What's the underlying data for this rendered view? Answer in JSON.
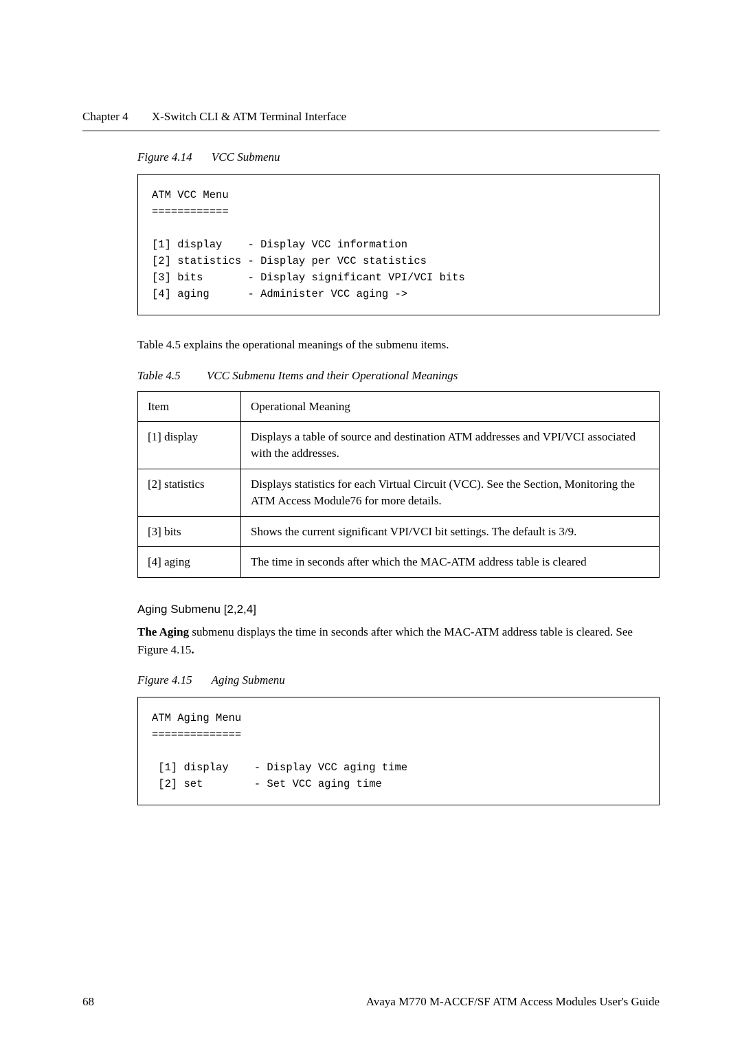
{
  "header": {
    "chapter_label": "Chapter 4",
    "chapter_title": "X-Switch CLI & ATM Terminal Interface"
  },
  "figure_4_14": {
    "label": "Figure 4.14",
    "title": "VCC Submenu",
    "code": "ATM VCC Menu\n============\n\n[1] display    - Display VCC information\n[2] statistics - Display per VCC statistics\n[3] bits       - Display significant VPI/VCI bits\n[4] aging      - Administer VCC aging ->"
  },
  "explain_text": "Table 4.5 explains the operational meanings of the submenu items.",
  "table_4_5": {
    "label": "Table 4.5",
    "title": "VCC Submenu Items and their Operational Meanings",
    "header_item": "Item",
    "header_meaning": "Operational Meaning",
    "rows": [
      {
        "item": "[1] display",
        "meaning": "Displays a table of source and destination ATM addresses and  VPI/VCI associated with the addresses."
      },
      {
        "item": "[2] statistics",
        "meaning": "Displays statistics for each Virtual Circuit (VCC). See the Section, Monitoring the ATM Access Module76 for more details."
      },
      {
        "item": "[3] bits",
        "meaning": "Shows the current significant VPI/VCI bit settings. The default is 3/9."
      },
      {
        "item": "[4] aging",
        "meaning": "The time in seconds after which the MAC-ATM address table is cleared"
      }
    ]
  },
  "aging_section": {
    "heading": "Aging Submenu [2,2,4]",
    "bold_lead": "The Aging",
    "rest": " submenu displays the time in seconds after which the MAC-ATM address table is cleared. See Figure 4.15",
    "tail_bold": "."
  },
  "figure_4_15": {
    "label": "Figure 4.15",
    "title": "Aging Submenu",
    "code": "ATM Aging Menu\n==============\n\n [1] display    - Display VCC aging time\n [2] set        - Set VCC aging time"
  },
  "footer": {
    "page": "68",
    "doc_title": "Avaya M770 M-ACCF/SF ATM Access Modules User's Guide"
  }
}
